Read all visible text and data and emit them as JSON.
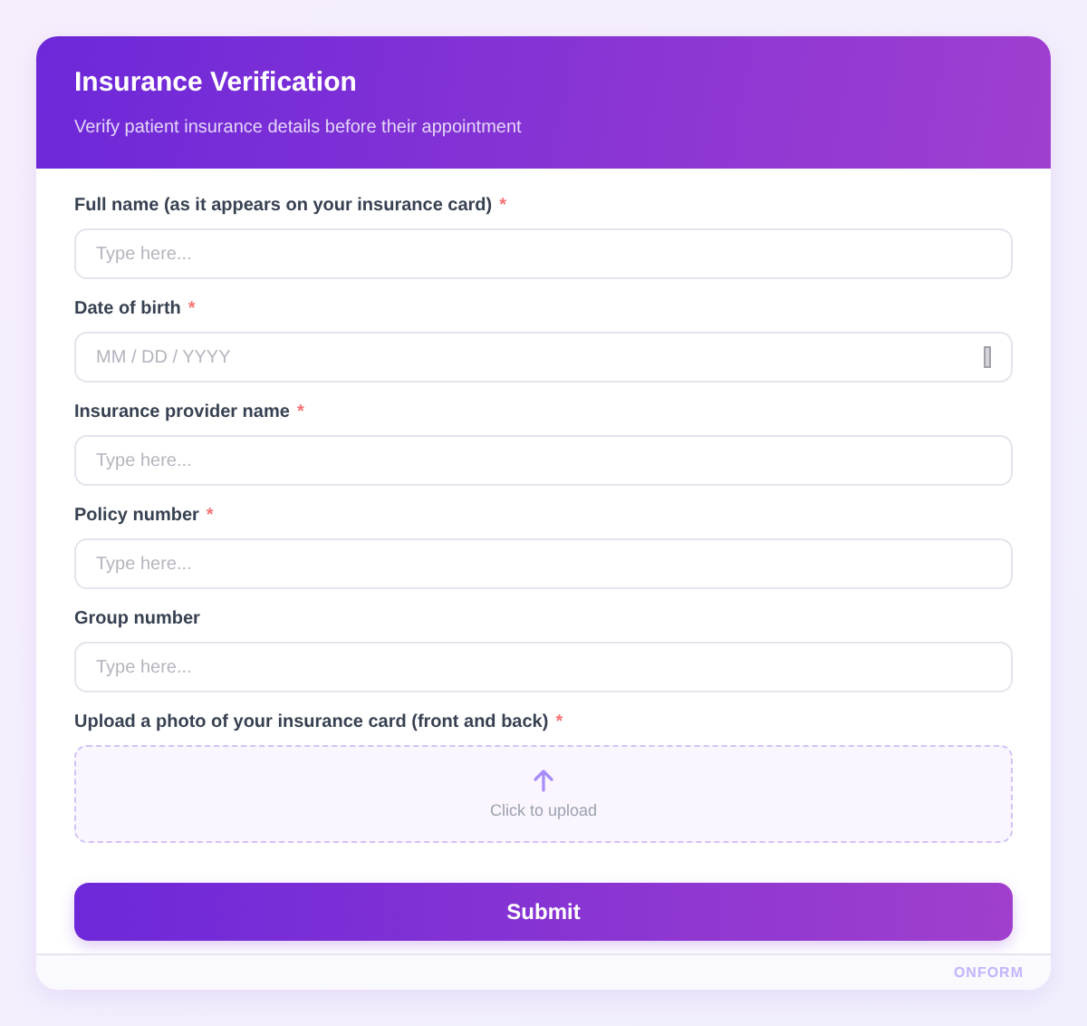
{
  "header": {
    "title": "Insurance Verification",
    "subtitle": "Verify patient insurance details before their appointment"
  },
  "fields": [
    {
      "kind": "text",
      "label": "Full name (as it appears on your insurance card)",
      "required_mark": "*",
      "placeholder": "Type here..."
    },
    {
      "kind": "date",
      "label": "Date of birth",
      "required_mark": "*",
      "placeholder": "MM / DD / YYYY"
    },
    {
      "kind": "text",
      "label": "Insurance provider name",
      "required_mark": "*",
      "placeholder": "Type here..."
    },
    {
      "kind": "text",
      "label": "Policy number",
      "required_mark": "*",
      "placeholder": "Type here..."
    },
    {
      "kind": "text",
      "label": "Group number",
      "placeholder": "Type here..."
    },
    {
      "kind": "upload",
      "label": "Upload a photo of your insurance card (front and back)",
      "required_mark": "*",
      "upload_text": "Click to upload"
    }
  ],
  "submit": "Submit",
  "footer": "ONFORM"
}
